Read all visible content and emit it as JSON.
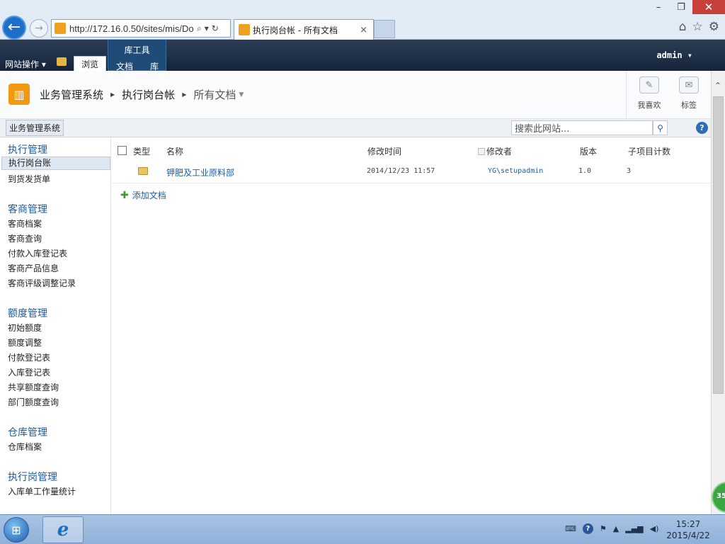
{
  "browser": {
    "address": "http://172.16.0.50/sites/mis/Do",
    "tab_title": "执行岗台帐 - 所有文档",
    "tab_close": "×",
    "min": "–",
    "restore": "❐",
    "close": "✕"
  },
  "ribbon": {
    "site_actions": "网站操作 ▾",
    "browse_tab": "浏览",
    "library_tools": "库工具",
    "tab_documents": "文档",
    "tab_library": "库",
    "user": "admin ▾"
  },
  "title_area": {
    "breadcrumb": [
      "业务管理系统",
      "执行岗台帐",
      "所有文档"
    ],
    "i_like_it": "我喜欢",
    "tags": "标签"
  },
  "topnav": {
    "home": "业务管理系统",
    "search_placeholder": "搜索此网站...",
    "help": "?"
  },
  "quicklaunch": {
    "sections": [
      {
        "heading": "执行管理",
        "items": [
          "执行岗台账",
          "到货发货单"
        ]
      },
      {
        "heading": "客商管理",
        "items": [
          "客商档案",
          "客商查询",
          "付款入库登记表",
          "客商产品信息",
          "客商评级调整记录"
        ]
      },
      {
        "heading": "额度管理",
        "items": [
          "初始额度",
          "额度调整",
          "付款登记表",
          "入库登记表",
          "共享额度查询",
          "部门额度查询"
        ]
      },
      {
        "heading": "仓库管理",
        "items": [
          "仓库档案"
        ]
      },
      {
        "heading": "执行岗管理",
        "items": [
          "入库单工作量统计"
        ]
      }
    ]
  },
  "list": {
    "columns": {
      "type": "类型",
      "name": "名称",
      "modified": "修改时间",
      "modified_by": "修改者",
      "version": "版本",
      "child_count": "子项目计数"
    },
    "rows": [
      {
        "name": "钾肥及工业原料部",
        "modified": "2014/12/23 11:57",
        "modified_by": "YG\\setupadmin",
        "version": "1.0",
        "child_count": "3"
      }
    ],
    "add_document": "添加文档"
  },
  "taskbar": {
    "time": "15:27",
    "date": "2015/4/22",
    "badge": "35"
  }
}
